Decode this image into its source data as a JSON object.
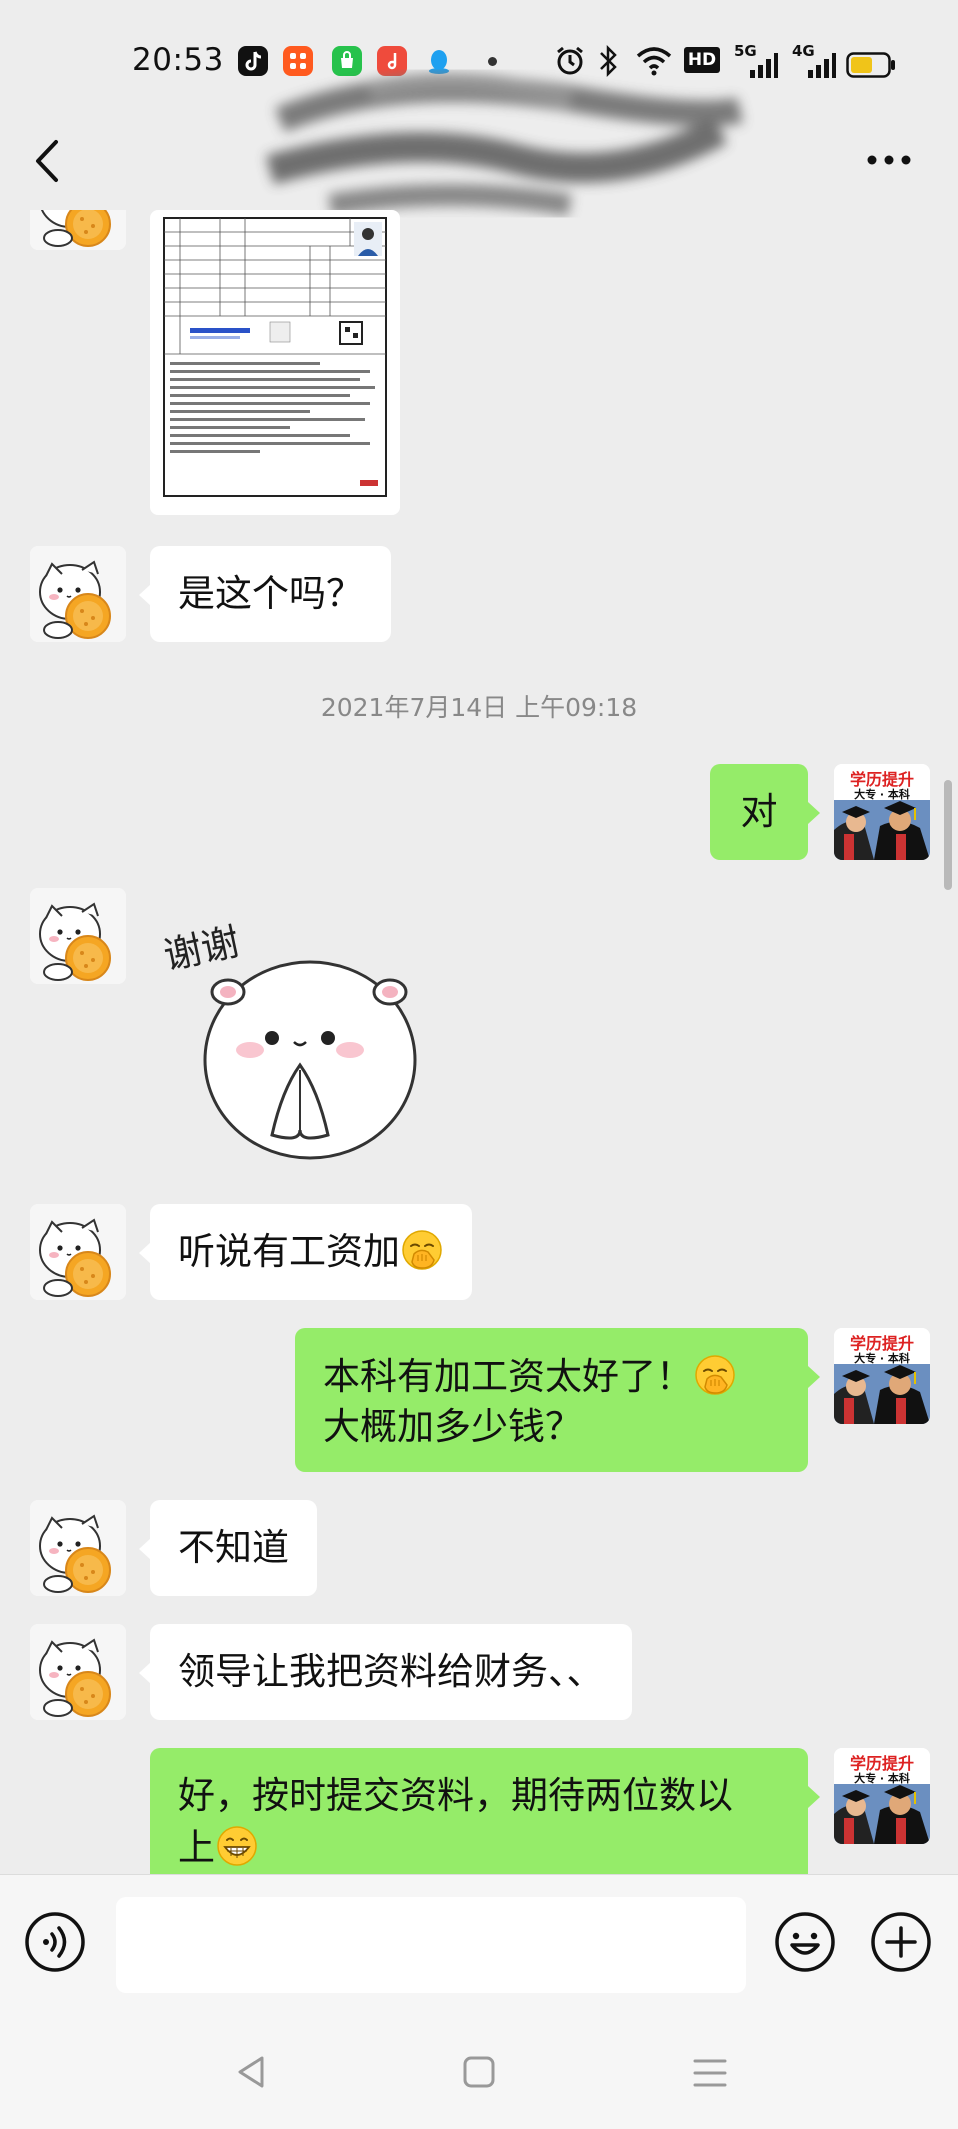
{
  "status_bar": {
    "time": "20:53",
    "apps": [
      "tiktok-icon",
      "app-grid-icon",
      "shopping-bag-icon",
      "music-icon",
      "qq-icon"
    ],
    "right_icons": [
      "alarm-icon",
      "bluetooth-icon",
      "wifi-icon",
      "hd-icon",
      "signal-5g-icon",
      "signal-4g-icon",
      "battery-icon"
    ],
    "hd_label": "HD",
    "net_5g": "5G",
    "net_4g": "4G",
    "battery_level": 0.6
  },
  "nav": {
    "back_icon": "back-chevron-icon",
    "more_icon": "more-dots-icon"
  },
  "avatars": {
    "grad_top": "学历提升",
    "grad_sub": "大专 · 本科"
  },
  "messages": [
    {
      "side": "left",
      "type": "image",
      "content": "document-card"
    },
    {
      "side": "left",
      "type": "text",
      "text": "是这个吗？"
    },
    {
      "type": "timestamp",
      "text": "2021年7月14日 上午09:18"
    },
    {
      "side": "right",
      "type": "text",
      "text": "对"
    },
    {
      "side": "left",
      "type": "sticker",
      "text": "谢谢"
    },
    {
      "side": "left",
      "type": "text",
      "text": "听说有工资加"
    },
    {
      "side": "right",
      "type": "text",
      "line1": "本科有加工资太好了！",
      "line2": "大概加多少钱？"
    },
    {
      "side": "left",
      "type": "text",
      "text": "不知道"
    },
    {
      "side": "left",
      "type": "text",
      "text": "领导让我把资料给财务、、"
    },
    {
      "side": "right",
      "type": "text",
      "line1": "好，按时提交资料，期待两位数以",
      "line2": "上"
    }
  ],
  "input": {
    "placeholder": ""
  },
  "colors": {
    "background": "#ededed",
    "right_bubble": "#95ec69",
    "left_bubble": "#ffffff",
    "timestamp": "#888888"
  }
}
